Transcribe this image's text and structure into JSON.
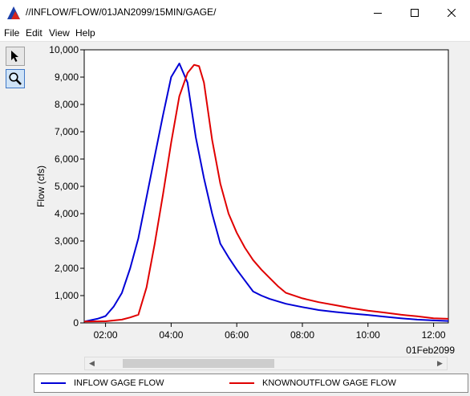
{
  "window": {
    "title": "//INFLOW/FLOW/01JAN2099/15MIN/GAGE/"
  },
  "menu": {
    "items": [
      "File",
      "Edit",
      "View",
      "Help"
    ]
  },
  "toolbox": {
    "tools": [
      {
        "icon": "pointer-arrow-icon"
      },
      {
        "icon": "zoom-magnifier-icon"
      }
    ]
  },
  "chart_data": {
    "type": "line",
    "ylabel": "Flow (cfs)",
    "xlabel": "01Feb2099",
    "ylim": [
      0,
      10000
    ],
    "yticks": [
      "0",
      "1,000",
      "2,000",
      "3,000",
      "4,000",
      "5,000",
      "6,000",
      "7,000",
      "8,000",
      "9,000",
      "10,000"
    ],
    "xlim_hours": [
      1.35,
      12.45
    ],
    "xticks": [
      {
        "label": "02:00",
        "hour": 2
      },
      {
        "label": "04:00",
        "hour": 4
      },
      {
        "label": "06:00",
        "hour": 6
      },
      {
        "label": "08:00",
        "hour": 8
      },
      {
        "label": "10:00",
        "hour": 10
      },
      {
        "label": "12:00",
        "hour": 12
      }
    ],
    "grid": false,
    "legend_position": "bottom",
    "series": [
      {
        "name": "INFLOW GAGE FLOW",
        "color": "#0000d6",
        "points": [
          [
            1.35,
            50
          ],
          [
            1.75,
            150
          ],
          [
            2.0,
            250
          ],
          [
            2.25,
            600
          ],
          [
            2.5,
            1100
          ],
          [
            2.75,
            2000
          ],
          [
            3.0,
            3100
          ],
          [
            3.25,
            4600
          ],
          [
            3.5,
            6100
          ],
          [
            3.75,
            7600
          ],
          [
            4.0,
            9000
          ],
          [
            4.25,
            9500
          ],
          [
            4.5,
            8800
          ],
          [
            4.75,
            6800
          ],
          [
            5.0,
            5300
          ],
          [
            5.25,
            4000
          ],
          [
            5.5,
            2900
          ],
          [
            5.75,
            2400
          ],
          [
            6.0,
            1950
          ],
          [
            6.25,
            1550
          ],
          [
            6.5,
            1150
          ],
          [
            6.75,
            1000
          ],
          [
            7.0,
            880
          ],
          [
            7.5,
            700
          ],
          [
            8.0,
            580
          ],
          [
            8.5,
            470
          ],
          [
            9.0,
            400
          ],
          [
            9.5,
            340
          ],
          [
            10.0,
            290
          ],
          [
            10.5,
            230
          ],
          [
            11.0,
            170
          ],
          [
            11.5,
            120
          ],
          [
            12.0,
            90
          ],
          [
            12.45,
            70
          ]
        ]
      },
      {
        "name": "KNOWNOUTFLOW GAGE FLOW",
        "color": "#e00000",
        "points": [
          [
            1.35,
            50
          ],
          [
            2.0,
            60
          ],
          [
            2.5,
            120
          ],
          [
            2.75,
            200
          ],
          [
            3.0,
            300
          ],
          [
            3.25,
            1300
          ],
          [
            3.5,
            2900
          ],
          [
            3.75,
            4700
          ],
          [
            4.0,
            6600
          ],
          [
            4.25,
            8300
          ],
          [
            4.5,
            9150
          ],
          [
            4.7,
            9450
          ],
          [
            4.85,
            9400
          ],
          [
            5.0,
            8800
          ],
          [
            5.25,
            6700
          ],
          [
            5.5,
            5100
          ],
          [
            5.75,
            4000
          ],
          [
            6.0,
            3300
          ],
          [
            6.25,
            2750
          ],
          [
            6.5,
            2300
          ],
          [
            6.75,
            1950
          ],
          [
            7.0,
            1650
          ],
          [
            7.25,
            1350
          ],
          [
            7.5,
            1100
          ],
          [
            8.0,
            900
          ],
          [
            8.5,
            760
          ],
          [
            9.0,
            650
          ],
          [
            9.5,
            540
          ],
          [
            10.0,
            450
          ],
          [
            10.5,
            380
          ],
          [
            11.0,
            300
          ],
          [
            11.5,
            240
          ],
          [
            12.0,
            170
          ],
          [
            12.45,
            150
          ]
        ]
      }
    ]
  }
}
